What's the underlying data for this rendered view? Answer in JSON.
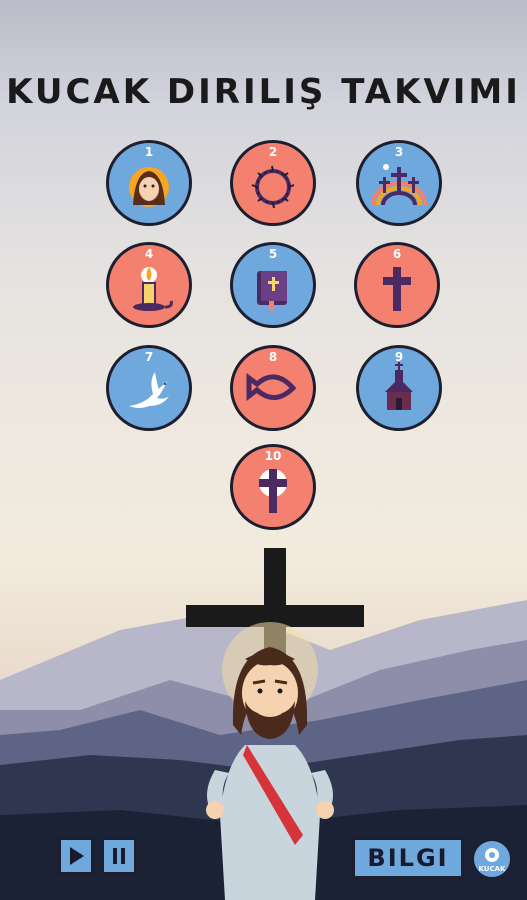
{
  "title": "KUCAK DIRILIŞ TAKVIMI",
  "days": [
    {
      "number": "1",
      "icon": "jesus-face-icon",
      "color": "blue"
    },
    {
      "number": "2",
      "icon": "crown-of-thorns-icon",
      "color": "salmon"
    },
    {
      "number": "3",
      "icon": "three-crosses-rainbow-icon",
      "color": "blue"
    },
    {
      "number": "4",
      "icon": "candle-icon",
      "color": "salmon"
    },
    {
      "number": "5",
      "icon": "bible-icon",
      "color": "blue"
    },
    {
      "number": "6",
      "icon": "cross-icon",
      "color": "salmon"
    },
    {
      "number": "7",
      "icon": "dove-icon",
      "color": "blue"
    },
    {
      "number": "8",
      "icon": "fish-icon",
      "color": "salmon"
    },
    {
      "number": "9",
      "icon": "church-icon",
      "color": "blue"
    },
    {
      "number": "10",
      "icon": "cross-halo-icon",
      "color": "salmon"
    }
  ],
  "controls": {
    "play": "play-icon",
    "pause": "pause-icon"
  },
  "info_button": "BILGI",
  "logo_text": "KUCAK",
  "colors": {
    "blue": "#6fa8dc",
    "salmon": "#f4806f",
    "outline": "#1d1f2e",
    "icon_purple": "#4b2a63"
  }
}
